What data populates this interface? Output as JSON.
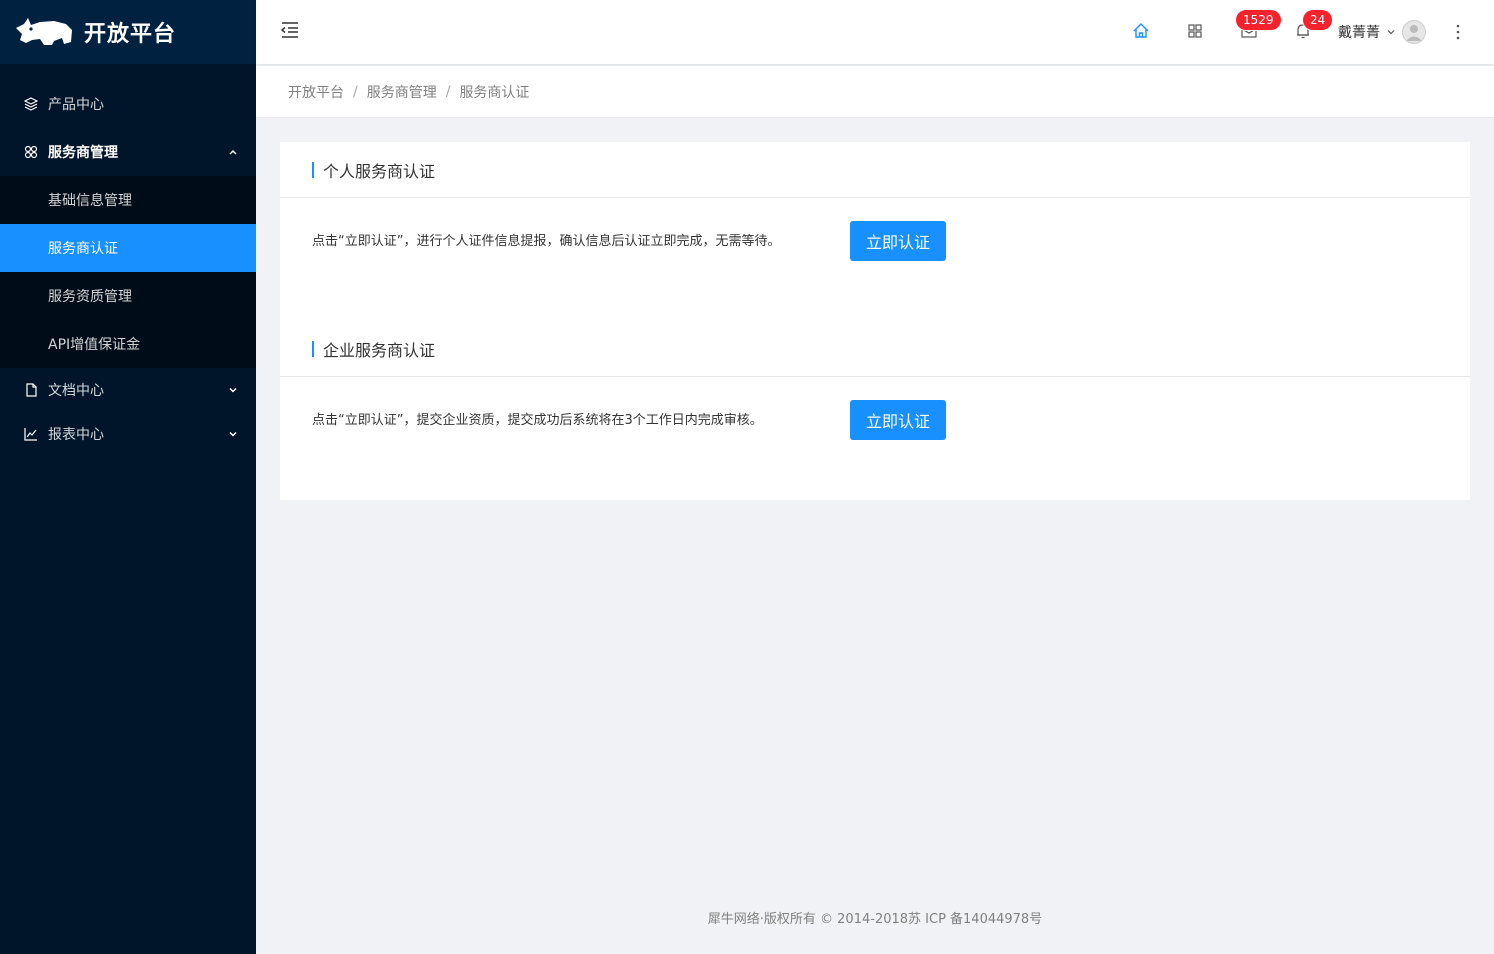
{
  "sidebar": {
    "brand": "开放平台",
    "menu": {
      "product": "产品中心",
      "provider": "服务商管理",
      "provider_sub": [
        "基础信息管理",
        "服务商认证",
        "服务资质管理",
        "API增值保证金"
      ],
      "docs": "文档中心",
      "reports": "报表中心"
    }
  },
  "header": {
    "mail_count": "1529",
    "notice_count": "24",
    "username": "戴菁菁"
  },
  "breadcrumb": [
    "开放平台",
    "服务商管理",
    "服务商认证"
  ],
  "cards": [
    {
      "title": "个人服务商认证",
      "description": "点击“立即认证”，进行个人证件信息提报，确认信息后认证立即完成，无需等待。",
      "button": "立即认证"
    },
    {
      "title": "企业服务商认证",
      "description": "点击“立即认证”，提交企业资质，提交成功后系统将在3个工作日内完成审核。",
      "button": "立即认证"
    }
  ],
  "footer": "犀牛网络·版权所有 © 2014-2018苏 ICP 备14044978号"
}
